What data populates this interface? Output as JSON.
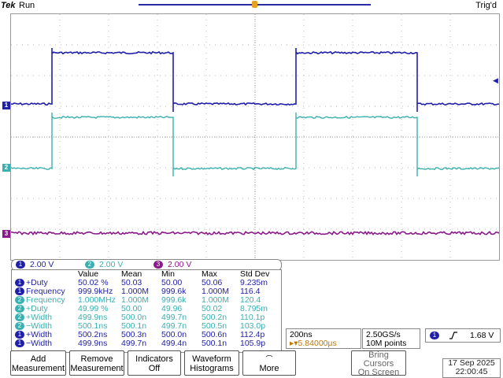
{
  "header": {
    "brand": "Tek",
    "run_state": "Run",
    "trigger_state": "Trig'd"
  },
  "colors": {
    "ch1": "#1f1fa8",
    "ch2": "#3bb0b0",
    "ch3": "#8a1a8a",
    "grid": "#b8b8b8",
    "trigger_marker": "#e8a020"
  },
  "channels": [
    {
      "num": "1",
      "scale": "2.00 V"
    },
    {
      "num": "2",
      "scale": "2.00 V"
    },
    {
      "num": "3",
      "scale": "2.00 V"
    }
  ],
  "measurements": {
    "headers": [
      "Value",
      "Mean",
      "Min",
      "Max",
      "Std Dev"
    ],
    "rows": [
      {
        "ch": "1",
        "name": "+Duty",
        "value": "50.02 %",
        "mean": "50.03",
        "min": "50.00",
        "max": "50.06",
        "std": "9.235m"
      },
      {
        "ch": "1",
        "name": "Frequency",
        "value": "999.9kHz",
        "mean": "1.000M",
        "min": "999.6k",
        "max": "1.000M",
        "std": "116.4"
      },
      {
        "ch": "2",
        "name": "Frequency",
        "value": "1.000MHz",
        "mean": "1.000M",
        "min": "999.6k",
        "max": "1.000M",
        "std": "120.4"
      },
      {
        "ch": "2",
        "name": "+Duty",
        "value": "49.99 %",
        "mean": "50.00",
        "min": "49.96",
        "max": "50.02",
        "std": "8.795m"
      },
      {
        "ch": "2",
        "name": "+Width",
        "value": "499.9ns",
        "mean": "500.0n",
        "min": "499.7n",
        "max": "500.2n",
        "std": "110.1p"
      },
      {
        "ch": "2",
        "name": "−Width",
        "value": "500.1ns",
        "mean": "500.1n",
        "min": "499.7n",
        "max": "500.5n",
        "std": "103.0p"
      },
      {
        "ch": "1",
        "name": "+Width",
        "value": "500.2ns",
        "mean": "500.3n",
        "min": "500.0n",
        "max": "500.6n",
        "std": "112.4p"
      },
      {
        "ch": "1",
        "name": "−Width",
        "value": "499.9ns",
        "mean": "499.7n",
        "min": "499.4n",
        "max": "500.1n",
        "std": "105.9p"
      }
    ]
  },
  "timebase": {
    "scale": "200ns",
    "position": "▸▾5.84000µs"
  },
  "acquisition": {
    "sample_rate": "2.50GS/s",
    "record_length": "10M points"
  },
  "trigger": {
    "source": "1",
    "slope_icon": "rising-edge",
    "level": "1.68 V"
  },
  "softkeys": [
    {
      "line1": "Add",
      "line2": "Measurement"
    },
    {
      "line1": "Remove",
      "line2": "Measurement"
    },
    {
      "line1": "Indicators",
      "line2": "Off"
    },
    {
      "line1": "Waveform",
      "line2": "Histograms"
    },
    {
      "line1": "",
      "line2": "More"
    },
    {
      "line1": "Bring",
      "line2": "Cursors",
      "line3": "On Screen"
    }
  ],
  "datetime": {
    "date": "17 Sep 2025",
    "time": "22:00:45"
  }
}
